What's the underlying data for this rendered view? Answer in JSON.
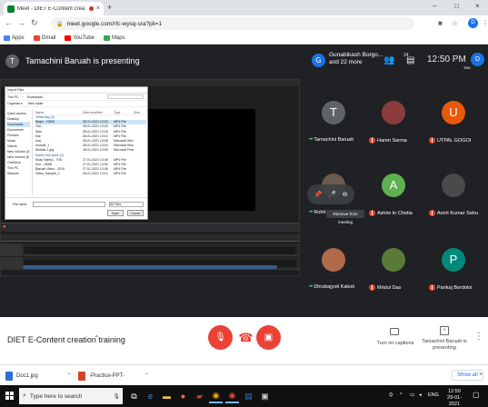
{
  "browser": {
    "tab_title": "Meet - DIET E-Content crea",
    "tab_close": "×",
    "new_tab": "+",
    "window_controls": [
      "–",
      "□",
      "×"
    ],
    "url": "meet.google.com/rfc-wysq-sra?pli=1",
    "profile_initial": "D",
    "bookmarks": [
      {
        "label": "Apps",
        "color": "#4285f4"
      },
      {
        "label": "Gmail",
        "color": "#ea4335"
      },
      {
        "label": "YouTube",
        "color": "#ff0000"
      },
      {
        "label": "Maps",
        "color": "#34a853"
      }
    ]
  },
  "meet": {
    "presenter": {
      "initial": "T",
      "text": "Tamachini Baruah is presenting"
    },
    "header": {
      "avatar_initial": "G",
      "names": "Gunabikash Borgo... and 22 more",
      "people_count": "24",
      "clock": "12:50 PM",
      "you_initial": "D",
      "you_label": "You"
    },
    "participants": [
      {
        "name": "Tamachini Baruah",
        "initial": "T",
        "color": "#5f6368",
        "state": "speaking"
      },
      {
        "name": "Haren Sarma",
        "initial": "",
        "color": "#8a3b3b",
        "state": "muted"
      },
      {
        "name": "UTPAL GOGOI",
        "initial": "U",
        "color": "#e8590c",
        "state": "muted"
      },
      {
        "name": "Rohit Chetia",
        "initial": "",
        "color": "#6b5a50",
        "state": "speaking"
      },
      {
        "name": "Ashim kr Chetia",
        "initial": "A",
        "color": "#5fb04f",
        "state": "muted"
      },
      {
        "name": "Amrit Kumar Sahu",
        "initial": "",
        "color": "#4a4a4a",
        "state": "muted"
      },
      {
        "name": "Dhrubajyoti Kakoti",
        "initial": "",
        "color": "#b06a4a",
        "state": "speaking"
      },
      {
        "name": "Mridul Das",
        "initial": "",
        "color": "#5a7a3a",
        "state": "muted"
      },
      {
        "name": "Pankaj Bordoloi",
        "initial": "P",
        "color": "#00897b",
        "state": "muted"
      }
    ],
    "tooltip": "Remove from meeting",
    "meeting_title": "DIET E-Content creation training",
    "captions_label": "Turn on captions",
    "presenting_label": "Tamachini Baruah is presenting"
  },
  "dialog": {
    "title": "Import Files",
    "path": [
      "This PC",
      "Downloads"
    ],
    "search_placeholder": "Search Downloads",
    "toolbar": [
      "Organize ▾",
      "New folder"
    ],
    "nav": [
      "Quick access",
      "Desktop",
      "Downloads",
      "Documents",
      "Pictures",
      "Music",
      "Videos",
      "New Volume (D:)",
      "New Volume (E:)",
      "OneDrive",
      "This PC",
      "Network"
    ],
    "columns": [
      "Name",
      "Date modified",
      "Type",
      "Size"
    ],
    "rows": [
      {
        "group": true,
        "name": "Yesterday (4)"
      },
      {
        "name": "Begin - HDMI",
        "date": "28-01-2021 13:20",
        "type": "MP4 File",
        "size": ""
      },
      {
        "name": "Two",
        "date": "28-01-2021 13:20",
        "type": "MP4 File",
        "size": ""
      },
      {
        "name": "Sam",
        "date": "28-01-2021 13:18",
        "type": "MP4 File",
        "size": ""
      },
      {
        "name": "Dat",
        "date": "28-01-2021 13:10",
        "type": "MP4 File",
        "size": ""
      },
      {
        "name": "Ima",
        "date": "28-01-2021 13:08",
        "type": "Microsoft Word",
        "size": ""
      },
      {
        "name": "module_1",
        "date": "28-01-2021 13:00",
        "type": "Microsoft Word",
        "size": ""
      },
      {
        "name": "Module-1.jpg",
        "date": "28-01-2021 13:00",
        "type": "Microsoft Power",
        "size": ""
      },
      {
        "group": true,
        "name": "Earlier this week (4)"
      },
      {
        "name": "Snap Sabha - 7HD",
        "date": "27-01-2021 13:46",
        "type": "MP4 File",
        "size": ""
      },
      {
        "name": "Doc - HDMI",
        "date": "27-01-2021 13:30",
        "type": "MP4 File",
        "size": ""
      },
      {
        "name": "Baruah Video - 2019",
        "date": "27-01-2021 13:06",
        "type": "MP4 File",
        "size": ""
      },
      {
        "name": "Video_Sample_2",
        "date": "26-01-2021 13:14",
        "type": "MP4 File",
        "size": ""
      }
    ],
    "context_menu": [
      "Item type: MP4 File",
      "Size: 2.21 MB",
      "Length: 00:01:10"
    ],
    "file_name_label": "File name:",
    "file_type": "All Files",
    "open": "Open",
    "cancel": "Cancel"
  },
  "shelf": {
    "items": [
      {
        "label": "Doc1.jpg",
        "color": "#2f6fd0"
      },
      {
        "label": "-Practice-PPT-",
        "color": "#d24726"
      }
    ],
    "show_all": "Show all",
    "close": "×"
  },
  "taskbar": {
    "search_text": "Type here to search",
    "lang": "ENG",
    "time": "12:50",
    "date": "29-01-2021"
  }
}
